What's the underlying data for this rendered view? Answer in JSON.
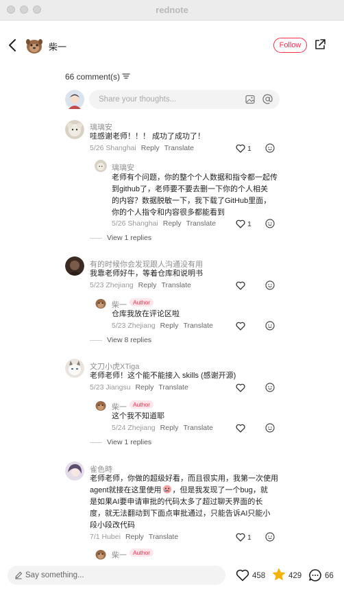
{
  "window": {
    "title": "rednote"
  },
  "header": {
    "author_name": "柴一",
    "follow_label": "Follow"
  },
  "comments_header": {
    "count_label": "66 comment(s)"
  },
  "composer": {
    "placeholder": "Share your thoughts..."
  },
  "comments": {
    "c1": {
      "nickname": "璃璃安",
      "text": "哇感谢老师！！！ 成功了成功了！",
      "date_loc": "5/26 Shanghai",
      "reply": "Reply",
      "translate": "Translate",
      "likes": "1",
      "sub": {
        "nickname": "璃璃安",
        "lines": [
          "老师有个问题，你的整个个人数据和指令都一起传",
          "到github了，老师要不要去删一下你的个人相关",
          "的内容？数据脱敏一下，我下载了GitHub里面，",
          "你的个人指令和内容很多都能看到"
        ],
        "date_loc": "5/26 Shanghai",
        "reply": "Reply",
        "translate": "Translate",
        "likes": "1"
      },
      "view_replies": "View 1 replies"
    },
    "c2": {
      "nickname": "有的时候你会发现跟人沟通没有用",
      "text": "我靠老师好牛，等着仓库和说明书",
      "date_loc": "5/23 Zhejiang",
      "reply": "Reply",
      "translate": "Translate",
      "sub": {
        "nickname": "柴一",
        "badge": "Author",
        "text": "仓库我放在评论区啦",
        "date_loc": "5/23 Zhejiang",
        "reply": "Reply",
        "translate": "Translate"
      },
      "view_replies": "View 8 replies"
    },
    "c3": {
      "nickname": "文刀小虎XTiga",
      "text": "老师老师！这个能不能接入 skills (感谢开源)",
      "date_loc": "5/23 Jiangsu",
      "reply": "Reply",
      "translate": "Translate",
      "sub": {
        "nickname": "柴一",
        "badge": "Author",
        "text": "这个我不知道耶",
        "date_loc": "5/24 Zhejiang",
        "reply": "Reply",
        "translate": "Translate"
      },
      "view_replies": "View 1 replies"
    },
    "c4": {
      "nickname": "雀色時",
      "line1": "老师老师，你做的超级好看，而且很实用，我第一次使用",
      "line2a": "agent就接在这里使用",
      "line2b": "，但是我发现了一个bug，就",
      "line3": "是如果AI要申请审批的代码太多了超过聊天界面的长",
      "line4": "度，就无法翻动到下面点审批通过，只能告诉AI只能小",
      "line5": "段小段改代码",
      "date_loc": "7/1 Hubei",
      "reply": "Reply",
      "translate": "Translate",
      "likes": "1",
      "sub": {
        "nickname": "柴一",
        "badge": "Author"
      }
    }
  },
  "bottom_bar": {
    "say_placeholder": "Say something...",
    "likes": "458",
    "stars": "429",
    "comments": "66"
  },
  "colors": {
    "accent": "#ff2e4d",
    "star": "#f5b301"
  }
}
